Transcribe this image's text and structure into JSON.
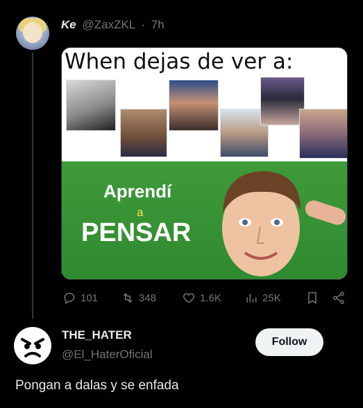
{
  "tweet": {
    "display_name": "Ke",
    "handle": "@ZaxZKL",
    "separator": "·",
    "time": "7h",
    "image": {
      "headline": "When dejas de ver a:",
      "word1": "Aprendí",
      "word2": "a",
      "word3": "PENSAR"
    },
    "actions": {
      "replies": "101",
      "retweets": "348",
      "likes": "1.6K",
      "views": "25K"
    }
  },
  "reply_user": {
    "display_name": "THE_HATER",
    "handle": "@El_HaterOficial",
    "follow_label": "Follow",
    "text": "Pongan a dalas y se enfada"
  },
  "colors": {
    "background": "#000000",
    "muted": "#71767b",
    "text": "#e7e9ea",
    "green": "#3f9a3a"
  }
}
